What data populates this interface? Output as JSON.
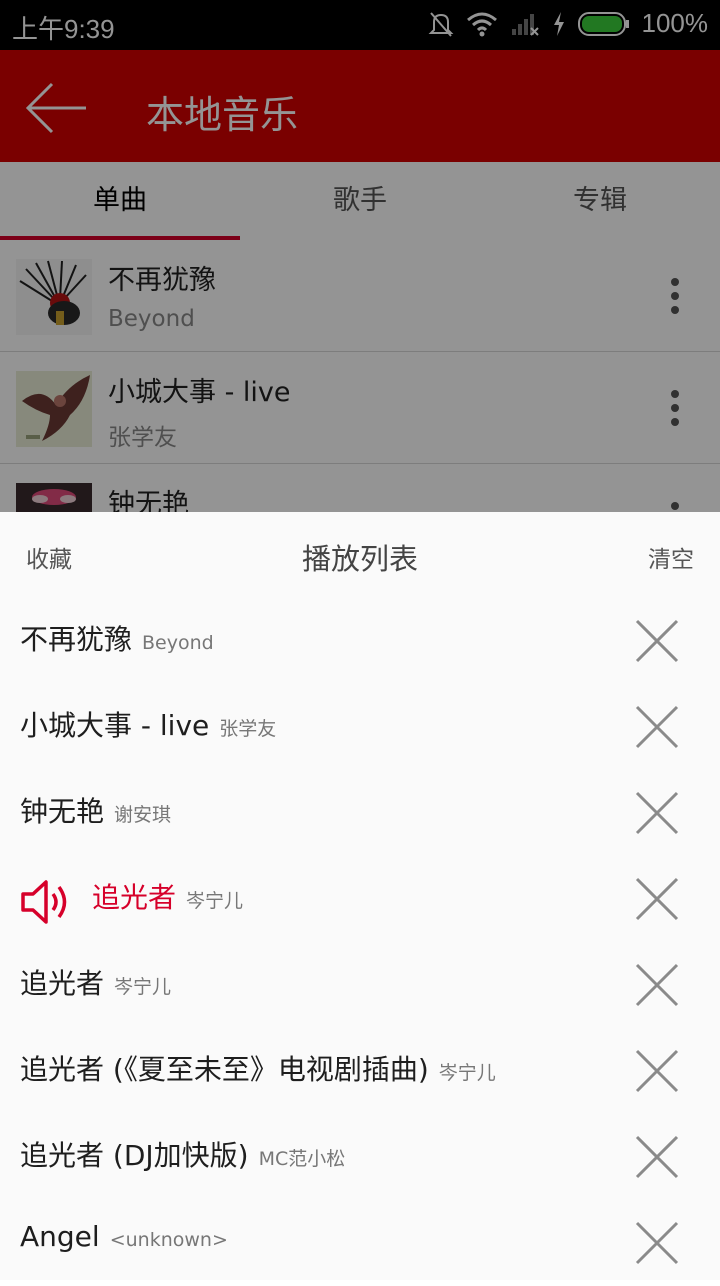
{
  "status_bar": {
    "time": "上午9:39",
    "battery": "100%"
  },
  "header": {
    "title": "本地音乐"
  },
  "tabs": [
    {
      "label": "单曲",
      "active": true
    },
    {
      "label": "歌手",
      "active": false
    },
    {
      "label": "专辑",
      "active": false
    }
  ],
  "songs": [
    {
      "title": "不再犹豫",
      "artist": "Beyond"
    },
    {
      "title": "小城大事 - live",
      "artist": "张学友"
    },
    {
      "title": "钟无艳",
      "artist": ""
    }
  ],
  "playlist": {
    "fav_label": "收藏",
    "title": "播放列表",
    "clear_label": "清空",
    "items": [
      {
        "title": "不再犹豫",
        "artist": "Beyond"
      },
      {
        "title": "小城大事 - live",
        "artist": "张学友"
      },
      {
        "title": "钟无艳",
        "artist": "谢安琪"
      },
      {
        "title": "追光者",
        "artist": "岑宁儿",
        "playing": true
      },
      {
        "title": "追光者",
        "artist": "岑宁儿"
      },
      {
        "title": "追光者 (《夏至未至》电视剧插曲)",
        "artist": "岑宁儿"
      },
      {
        "title": "追光者 (DJ加快版)",
        "artist": "MC范小松"
      },
      {
        "title": "Angel",
        "artist": "<unknown>"
      }
    ]
  },
  "colors": {
    "accent": "#d20000",
    "playing": "#d6002a"
  }
}
